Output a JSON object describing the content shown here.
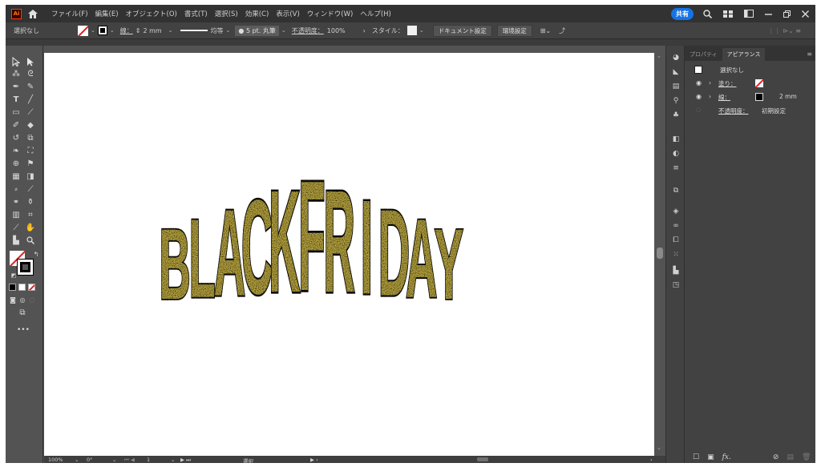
{
  "menubar": {
    "logo_text": "Ai",
    "items": [
      "ファイル(F)",
      "編集(E)",
      "オブジェクト(O)",
      "書式(T)",
      "選択(S)",
      "効果(C)",
      "表示(V)",
      "ウィンドウ(W)",
      "ヘルプ(H)"
    ],
    "share_label": "共有"
  },
  "control": {
    "selection": "選択なし",
    "stroke_label": "線：",
    "stroke_value": "2 mm",
    "profile_label": "均等",
    "brush_label": "5 pt. 丸筆",
    "opacity_label": "不透明度：",
    "opacity_value": "100%",
    "style_label": "スタイル：",
    "doc_setup": "ドキュメント設定",
    "prefs": "環境設定"
  },
  "artwork": {
    "text": "BLACKFRIDAY",
    "fill_color": "#b9a640",
    "stroke_color": "#111111"
  },
  "status": {
    "zoom": "100%",
    "rotation": "0°",
    "artboard": "1",
    "mode": "選択"
  },
  "panel": {
    "tab_properties": "プロパティ",
    "tab_appearance": "アピアランス",
    "selection": "選択なし",
    "fill_label": "塗り：",
    "stroke_label": "線：",
    "stroke_value": "2 mm",
    "opacity_label": "不透明度：",
    "opacity_value": "初期設定",
    "fx_label": "fx."
  },
  "colors": {
    "ui_dark": "#323232",
    "ui_mid": "#535353",
    "accent": "#1473e6",
    "none_slash": "#e02020"
  }
}
